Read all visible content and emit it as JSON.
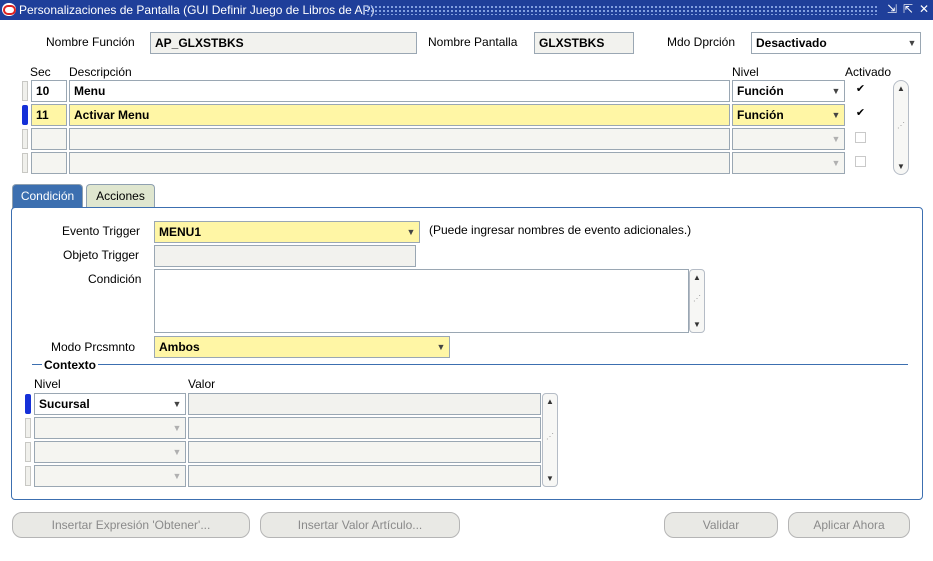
{
  "window": {
    "title": "Personalizaciones de Pantalla (GUI Definir Juego de Libros de AP)",
    "controls": [
      "⇲",
      "⇱",
      "✕"
    ]
  },
  "header": {
    "function_label": "Nombre Función",
    "function_value": "AP_GLXSTBKS",
    "form_label": "Nombre Pantalla",
    "form_value": "GLXSTBKS",
    "debug_label": "Mdo Dprción",
    "debug_value": "Desactivado"
  },
  "rules": {
    "col_seq": "Sec",
    "col_desc": "Descripción",
    "col_level": "Nivel",
    "col_enabled": "Activado",
    "rows": [
      {
        "seq": "10",
        "desc": "Menu",
        "level": "Función",
        "enabled": "✔"
      },
      {
        "seq": "11",
        "desc": "Activar Menu",
        "level": "Función",
        "enabled": "✔"
      },
      {
        "seq": "",
        "desc": "",
        "level": "",
        "enabled": ""
      },
      {
        "seq": "",
        "desc": "",
        "level": "",
        "enabled": ""
      }
    ]
  },
  "tabs": {
    "condition": "Condición",
    "actions": "Acciones"
  },
  "condition": {
    "trigger_event_label": "Evento Trigger",
    "trigger_event_value": "MENU1",
    "trigger_hint": "(Puede ingresar nombres de evento adicionales.)",
    "trigger_object_label": "Objeto Trigger",
    "trigger_object_value": "",
    "condition_label": "Condición",
    "condition_value": "",
    "processing_mode_label": "Modo Prcsmnto",
    "processing_mode_value": "Ambos"
  },
  "context": {
    "title": "Contexto",
    "col_level": "Nivel",
    "col_value": "Valor",
    "rows": [
      {
        "level": "Sucursal",
        "value": ""
      },
      {
        "level": "",
        "value": ""
      },
      {
        "level": "",
        "value": ""
      },
      {
        "level": "",
        "value": ""
      }
    ]
  },
  "buttons": {
    "insert_get_expression": "Insertar Expresión 'Obtener'...",
    "insert_item_value": "Insertar Valor Artículo...",
    "validate": "Validar",
    "apply_now": "Aplicar Ahora"
  }
}
